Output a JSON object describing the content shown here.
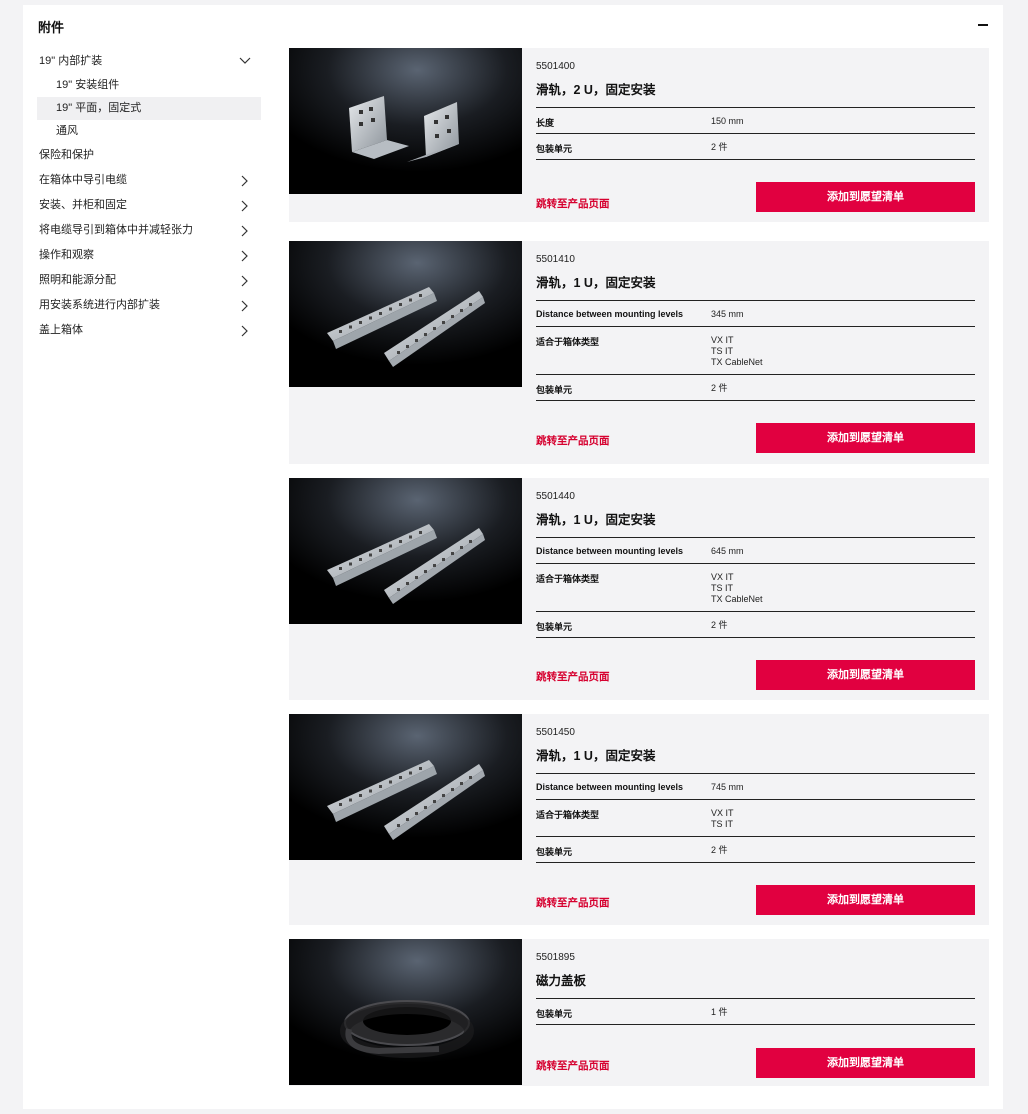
{
  "panel": {
    "title": "附件"
  },
  "sidebar": {
    "items": [
      {
        "label": "19\" 内部扩装",
        "chevron": "down"
      },
      {
        "label": "19\" 安装组件",
        "sub": true
      },
      {
        "label": "19\" 平面，固定式",
        "sub": true,
        "selected": true
      },
      {
        "label": "通风",
        "sub": true
      },
      {
        "label": "保险和保护"
      },
      {
        "label": "在箱体中导引电缆",
        "chevron": "right"
      },
      {
        "label": "安装、并柜和固定",
        "chevron": "right"
      },
      {
        "label": "将电缆导引到箱体中并减轻张力",
        "chevron": "right"
      },
      {
        "label": "操作和观察",
        "chevron": "right"
      },
      {
        "label": "照明和能源分配",
        "chevron": "right"
      },
      {
        "label": "用安装系统进行内部扩装",
        "chevron": "right"
      },
      {
        "label": "盖上箱体",
        "chevron": "right"
      }
    ]
  },
  "products": [
    {
      "number": "5501400",
      "name": "滑轨，2 U，固定安装",
      "image": "bracket-pair",
      "specs": [
        {
          "key": "长度",
          "value": "150 mm"
        },
        {
          "key": "包装单元",
          "value": "2 件"
        }
      ],
      "link": "跳转至产品页面",
      "cta": "添加到愿望清单"
    },
    {
      "number": "5501410",
      "name": "滑轨，1 U，固定安装",
      "image": "rail-pair",
      "specs": [
        {
          "key": "Distance between mounting levels",
          "value": "345 mm"
        },
        {
          "key": "适合于箱体类型",
          "value": "VX IT\nTS IT\nTX CableNet"
        },
        {
          "key": "包装单元",
          "value": "2 件"
        }
      ],
      "link": "跳转至产品页面",
      "cta": "添加到愿望清单"
    },
    {
      "number": "5501440",
      "name": "滑轨，1 U，固定安装",
      "image": "rail-pair",
      "specs": [
        {
          "key": "Distance between mounting levels",
          "value": "645 mm"
        },
        {
          "key": "适合于箱体类型",
          "value": "VX IT\nTS IT\nTX CableNet"
        },
        {
          "key": "包装单元",
          "value": "2 件"
        }
      ],
      "link": "跳转至产品页面",
      "cta": "添加到愿望清单"
    },
    {
      "number": "5501450",
      "name": "滑轨，1 U，固定安装",
      "image": "rail-pair",
      "specs": [
        {
          "key": "Distance between mounting levels",
          "value": "745 mm"
        },
        {
          "key": "适合于箱体类型",
          "value": "VX IT\nTS IT"
        },
        {
          "key": "包装单元",
          "value": "2 件"
        }
      ],
      "link": "跳转至产品页面",
      "cta": "添加到愿望清单"
    },
    {
      "number": "5501895",
      "name": "磁力盖板",
      "image": "magnetic-strip-roll",
      "specs": [
        {
          "key": "包装单元",
          "value": "1 件"
        }
      ],
      "link": "跳转至产品页面",
      "cta": "添加到愿望清单"
    }
  ]
}
